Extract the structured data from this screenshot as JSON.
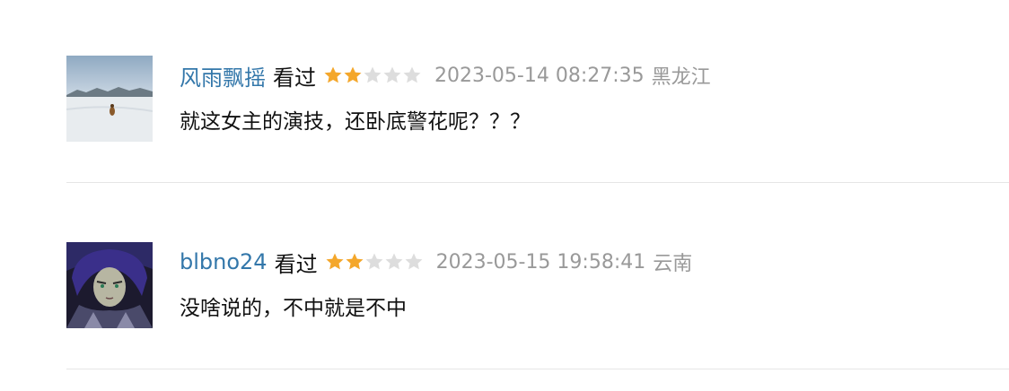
{
  "comments": [
    {
      "username": "风雨飘摇",
      "status": "看过",
      "rating": 2,
      "rating_max": 5,
      "time": "2023-05-14 08:27:35",
      "location": "黑龙江",
      "content": "就这女主的演技，还卧底警花呢？？？"
    },
    {
      "username": "blbno24",
      "status": "看过",
      "rating": 2,
      "rating_max": 5,
      "time": "2023-05-15 19:58:41",
      "location": "云南",
      "content": "没啥说的，不中就是不中"
    }
  ],
  "colors": {
    "username": "#3377aa",
    "star_filled": "#f4a72b",
    "star_empty": "#dddddd",
    "muted": "#999999"
  },
  "icons": {
    "star_filled": "star-filled-icon",
    "star_empty": "star-empty-icon"
  }
}
